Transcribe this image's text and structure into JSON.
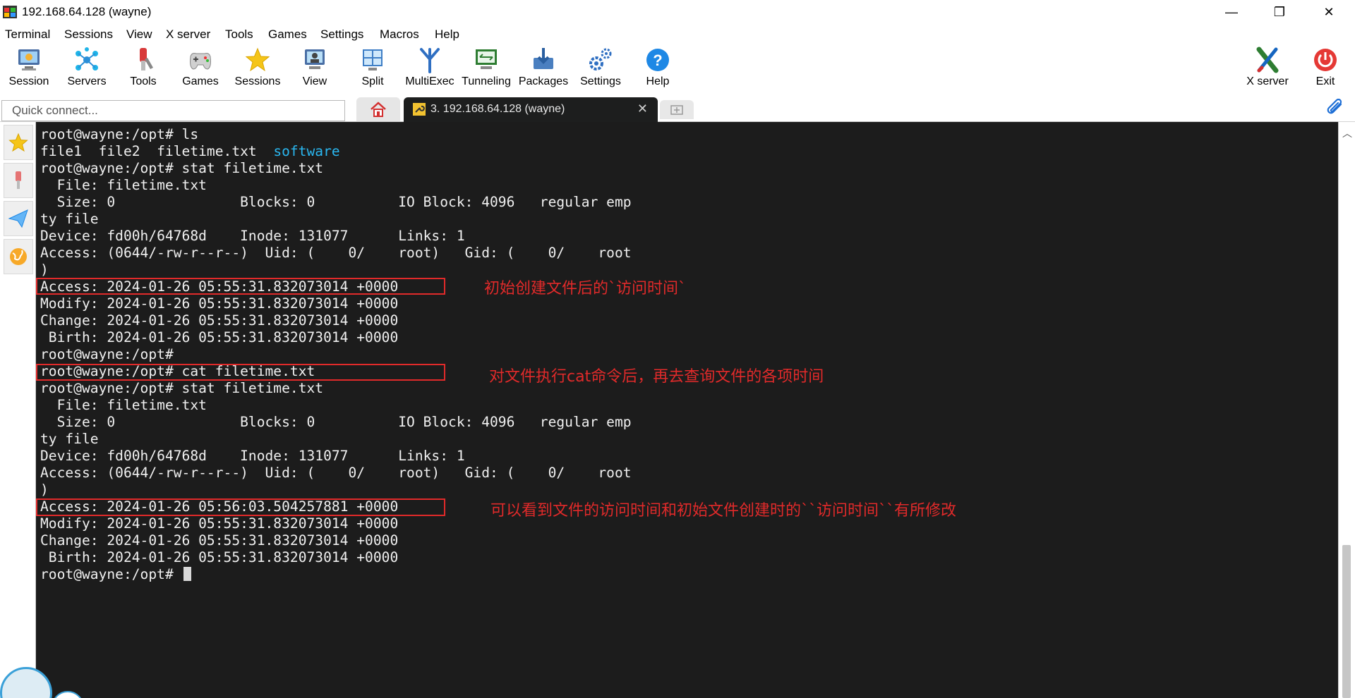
{
  "window": {
    "title": "192.168.64.128 (wayne)",
    "minimize_glyph": "—",
    "maximize_glyph": "❐",
    "close_glyph": "✕"
  },
  "menu": [
    "Terminal",
    "Sessions",
    "View",
    "X server",
    "Tools",
    "Games",
    "Settings",
    "Macros",
    "Help"
  ],
  "toolbar": {
    "left": [
      {
        "label": "Session",
        "icon": "session-icon"
      },
      {
        "label": "Servers",
        "icon": "servers-icon"
      },
      {
        "label": "Tools",
        "icon": "tools-icon"
      },
      {
        "label": "Games",
        "icon": "games-icon"
      },
      {
        "label": "Sessions",
        "icon": "sessions-star-icon"
      },
      {
        "label": "View",
        "icon": "view-icon"
      },
      {
        "label": "Split",
        "icon": "split-icon"
      },
      {
        "label": "MultiExec",
        "icon": "multiexec-icon"
      },
      {
        "label": "Tunneling",
        "icon": "tunneling-icon"
      },
      {
        "label": "Packages",
        "icon": "packages-icon"
      },
      {
        "label": "Settings",
        "icon": "settings-icon"
      },
      {
        "label": "Help",
        "icon": "help-icon"
      }
    ],
    "right": [
      {
        "label": "X server",
        "icon": "xserver-icon"
      },
      {
        "label": "Exit",
        "icon": "exit-icon"
      }
    ]
  },
  "quick_connect": {
    "placeholder": "Quick connect..."
  },
  "tabs": {
    "active_label": "3. 192.168.64.128 (wayne)",
    "close_glyph": "✕"
  },
  "terminal": {
    "lines": [
      "root@wayne:/opt# ls",
      "file1  file2  filetime.txt  ",
      "root@wayne:/opt# stat filetime.txt",
      "  File: filetime.txt",
      "  Size: 0               Blocks: 0          IO Block: 4096   regular emp",
      "ty file",
      "Device: fd00h/64768d    Inode: 131077      Links: 1",
      "Access: (0644/-rw-r--r--)  Uid: (    0/    root)   Gid: (    0/    root",
      ")",
      "Access: 2024-01-26 05:55:31.832073014 +0000",
      "Modify: 2024-01-26 05:55:31.832073014 +0000",
      "Change: 2024-01-26 05:55:31.832073014 +0000",
      " Birth: 2024-01-26 05:55:31.832073014 +0000",
      "root@wayne:/opt#",
      "root@wayne:/opt# cat filetime.txt",
      "root@wayne:/opt# stat filetime.txt",
      "  File: filetime.txt",
      "  Size: 0               Blocks: 0          IO Block: 4096   regular emp",
      "ty file",
      "Device: fd00h/64768d    Inode: 131077      Links: 1",
      "Access: (0644/-rw-r--r--)  Uid: (    0/    root)   Gid: (    0/    root",
      ")",
      "Access: 2024-01-26 05:56:03.504257881 +0000",
      "Modify: 2024-01-26 05:55:31.832073014 +0000",
      "Change: 2024-01-26 05:55:31.832073014 +0000",
      " Birth: 2024-01-26 05:55:31.832073014 +0000",
      "root@wayne:/opt# "
    ],
    "dir_entry": "software",
    "colors": {
      "background": "#1c1c1c",
      "text": "#f0f0f0",
      "directory": "#2ab7f0",
      "annotation": "#e12a2a"
    }
  },
  "annotations": [
    "初始创建文件后的`访问时间`",
    "对文件执行cat命令后，再去查询文件的各项时间",
    "可以看到文件的访问时间和初始文件创建时的``访问时间``有所修改"
  ]
}
